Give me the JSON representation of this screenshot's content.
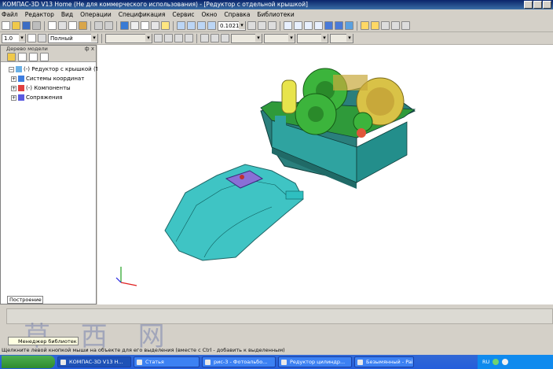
{
  "window": {
    "title": "КОМПАС-3D V13 Home (Не для коммерческого использования) - [Редуктор с отдельной крышкой]"
  },
  "menu": [
    "Файл",
    "Редактор",
    "Вид",
    "Операции",
    "Спецификация",
    "Сервис",
    "Окно",
    "Справка",
    "Библиотеки"
  ],
  "toolbar": {
    "zoom": "0.1021",
    "line_width": "1.0",
    "line_style": "Полный"
  },
  "tree": {
    "header": "Дерево модели",
    "pin": "ф x",
    "root": "(-) Редуктор с крышкой (Тел",
    "items": [
      "Системы координат",
      "(-) Компоненты",
      "Сопряжения"
    ],
    "footer_tab": "Построение"
  },
  "library_tab": "Менеджер библиотек",
  "status": "Щелкните левой кнопкой мыши на объекте для его выделения (вместе с Ctrl - добавить к выделенным)",
  "watermark": "草 西 网",
  "taskbar": {
    "buttons": [
      "КОМПАС-3D V13 H...",
      "Статья",
      "рис-3 - Фотоальбо...",
      "Редуктор цилиндр...",
      "Безымянный - Paint"
    ],
    "lang": "RU"
  },
  "colors": {
    "housing": "#2fa3a0",
    "cover": "#2fbfc0",
    "gear_green": "#3cb43c",
    "gear_yellow": "#d9c247",
    "accent": "#0a246a"
  }
}
